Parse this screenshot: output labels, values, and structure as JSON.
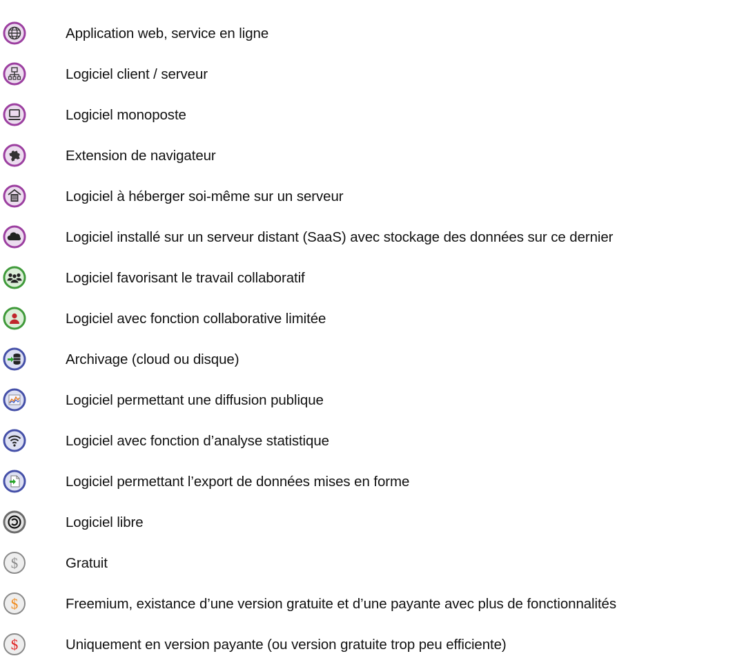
{
  "legend": {
    "items": [
      {
        "icon": "globe-icon",
        "label": "Application web, service en ligne",
        "ring": "#9c3fa0",
        "fill": "#ecdcef"
      },
      {
        "icon": "network-icon",
        "label": "Logiciel client / serveur",
        "ring": "#9c3fa0",
        "fill": "#ecdcef"
      },
      {
        "icon": "laptop-icon",
        "label": "Logiciel monoposte",
        "ring": "#9c3fa0",
        "fill": "#ecdcef"
      },
      {
        "icon": "puzzle-icon",
        "label": "Extension de navigateur",
        "ring": "#9c3fa0",
        "fill": "#ecdcef"
      },
      {
        "icon": "server-home-icon",
        "label": "Logiciel à héberger soi-même sur un serveur",
        "ring": "#9c3fa0",
        "fill": "#ecdcef"
      },
      {
        "icon": "cloud-icon",
        "label": "Logiciel installé sur un serveur distant (SaaS) avec stockage des données sur ce dernier",
        "ring": "#9c3fa0",
        "fill": "#ecdcef"
      },
      {
        "icon": "group-users-icon",
        "label": "Logiciel favorisant le travail collaboratif",
        "ring": "#3f9a3a",
        "fill": "#dcefd9"
      },
      {
        "icon": "single-user-icon",
        "label": "Logiciel avec fonction collaborative limitée",
        "ring": "#3f9a3a",
        "fill": "#dcefd9"
      },
      {
        "icon": "database-archive-icon",
        "label": "Archivage (cloud ou disque)",
        "ring": "#4550a8",
        "fill": "#dde0f3"
      },
      {
        "icon": "chart-icon",
        "label": "Logiciel permettant une diffusion publique",
        "ring": "#4550a8",
        "fill": "#dde0f3"
      },
      {
        "icon": "wifi-icon",
        "label": "Logiciel avec fonction d’analyse statistique",
        "ring": "#4550a8",
        "fill": "#dde0f3"
      },
      {
        "icon": "export-document-icon",
        "label": "Logiciel permettant l’export de données mises en forme",
        "ring": "#4550a8",
        "fill": "#dde0f3"
      },
      {
        "icon": "copyleft-icon",
        "label": "Logiciel libre",
        "ring": "#6a6a6a",
        "fill": "#e4e4e4"
      },
      {
        "icon": "dollar-grey-icon",
        "label": "Gratuit",
        "ring": "#8a8a8a",
        "fill": "#eeeeee",
        "symbol": "#8a8a8a"
      },
      {
        "icon": "dollar-orange-icon",
        "label": "Freemium, existance d’une version gratuite et d’une payante avec plus de fonctionnalités",
        "ring": "#8a8a8a",
        "fill": "#eeeeee",
        "symbol": "#f08a1c"
      },
      {
        "icon": "dollar-red-icon",
        "label": "Uniquement en version payante (ou version gratuite trop peu efficiente)",
        "ring": "#8a8a8a",
        "fill": "#eeeeee",
        "symbol": "#e02020"
      }
    ]
  }
}
